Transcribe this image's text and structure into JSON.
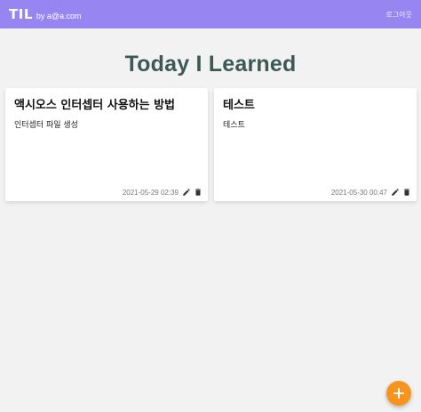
{
  "header": {
    "brand": "TIL",
    "user": "by a@a.com",
    "logout_label": "로그아웃"
  },
  "page": {
    "title": "Today I Learned"
  },
  "cards": [
    {
      "title": "액시오스 인터셉터 사용하는 방법",
      "body": "인터셉터 파일 생성",
      "date": "2021-05-29 02:39"
    },
    {
      "title": "테스트",
      "body": "테스트",
      "date": "2021-05-30 00:47"
    }
  ],
  "icons": {
    "edit": "pencil-icon",
    "delete": "trash-icon",
    "add": "plus-icon"
  },
  "colors": {
    "header_bg": "#9785f2",
    "title_text": "#3c5a52",
    "fab_bg": "#f7941d",
    "page_bg": "#f2f2f2"
  }
}
